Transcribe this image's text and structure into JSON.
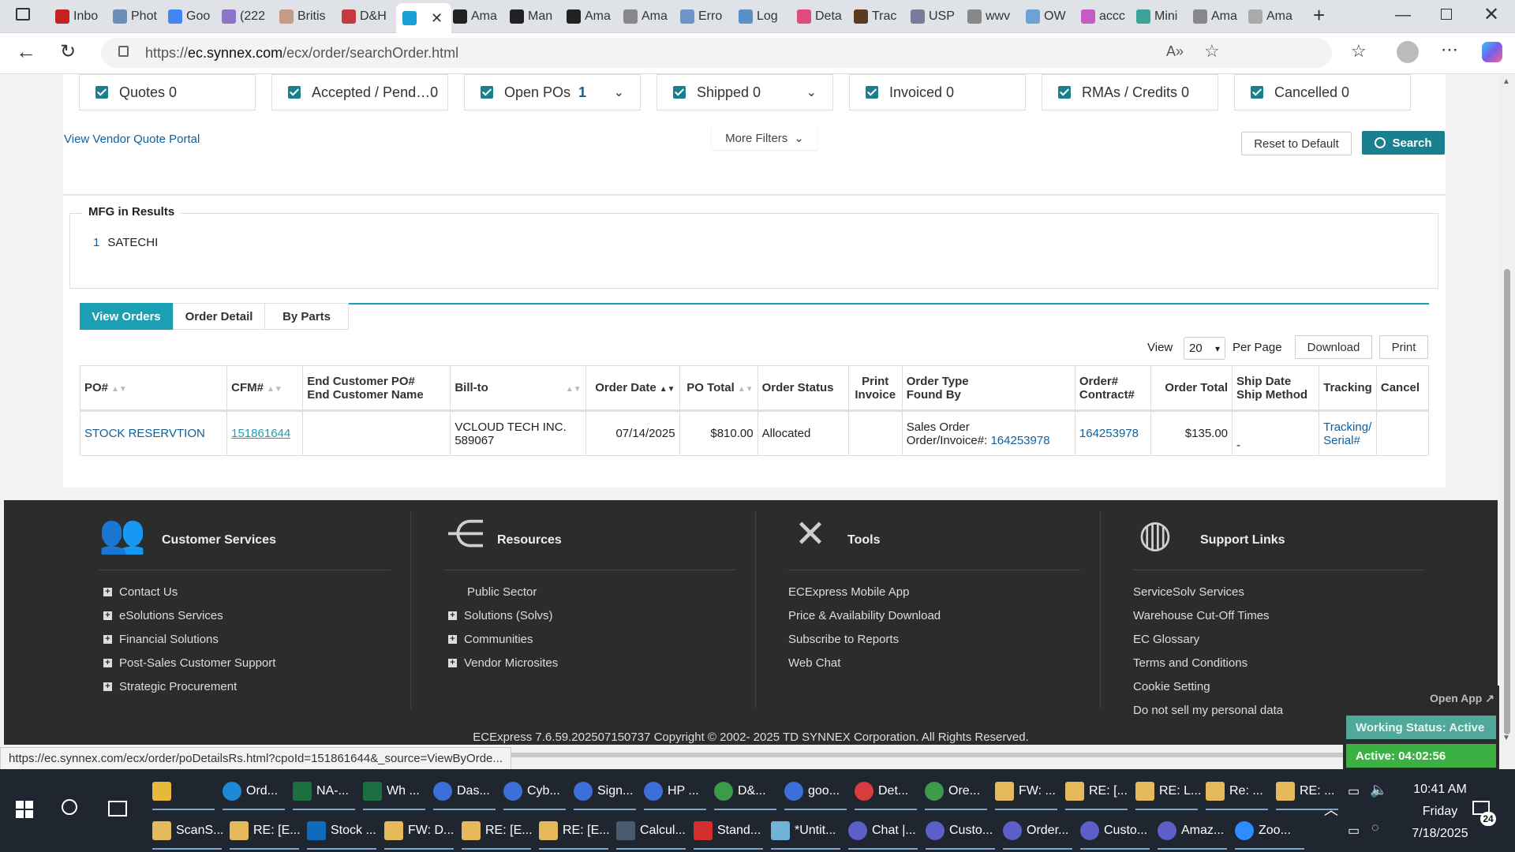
{
  "browser": {
    "tabs": [
      {
        "label": "Inbo",
        "icon": "gmail-icon",
        "color": "#c5221f"
      },
      {
        "label": "Phot",
        "icon": "photo-icon",
        "color": "#6b8db8"
      },
      {
        "label": "Goo",
        "icon": "google-icon",
        "color": "#4285f4"
      },
      {
        "label": "(222",
        "icon": "mail-icon",
        "color": "#8f73c9"
      },
      {
        "label": "Britis",
        "icon": "british-icon",
        "color": "#c79a86"
      },
      {
        "label": "D&H",
        "icon": "dh-icon",
        "color": "#c43b3b"
      },
      {
        "label": "",
        "icon": "ec-icon",
        "color": "#1a9fd6",
        "active": true
      },
      {
        "label": "Ama",
        "icon": "amazon-icon",
        "color": "#222222"
      },
      {
        "label": "Man",
        "icon": "amazon-icon",
        "color": "#222222"
      },
      {
        "label": "Ama",
        "icon": "amazon-icon",
        "color": "#222222"
      },
      {
        "label": "Ama",
        "icon": "amazon-gray-icon",
        "color": "#888888"
      },
      {
        "label": "Erro",
        "icon": "error-icon",
        "color": "#6e95c7"
      },
      {
        "label": "Log",
        "icon": "log-icon",
        "color": "#5b8fc7"
      },
      {
        "label": "Deta",
        "icon": "detail-icon",
        "color": "#e04b7a"
      },
      {
        "label": "Trac",
        "icon": "ups-icon",
        "color": "#5a3a1f"
      },
      {
        "label": "USP",
        "icon": "usps-icon",
        "color": "#7a7a9a"
      },
      {
        "label": "wwv",
        "icon": "link-icon",
        "color": "#888888"
      },
      {
        "label": "OW",
        "icon": "ow-icon",
        "color": "#6ba2d8"
      },
      {
        "label": "accc",
        "icon": "acc-icon",
        "color": "#c45cc4"
      },
      {
        "label": "Mini",
        "icon": "mini-icon",
        "color": "#3aa39a"
      },
      {
        "label": "Ama",
        "icon": "amazon-gray-icon",
        "color": "#888888"
      },
      {
        "label": "Ama",
        "icon": "amazon-gray-icon",
        "color": "#aaaaaa"
      }
    ],
    "url_prefix": "https://",
    "url_domain": "ec.synnex.com",
    "url_path": "/ecx/order/searchOrder.html"
  },
  "filters": [
    {
      "label": "Quotes 0",
      "dropdown": false
    },
    {
      "label": "Accepted / Pend…0",
      "dropdown": false
    },
    {
      "label": "Open POs",
      "count": "1",
      "dropdown": true
    },
    {
      "label": "Shipped 0",
      "dropdown": true
    },
    {
      "label": "Invoiced 0",
      "dropdown": false
    },
    {
      "label": "RMAs / Credits 0",
      "dropdown": false
    },
    {
      "label": "Cancelled 0",
      "dropdown": false
    }
  ],
  "toolbar": {
    "vendor_link": "View Vendor Quote Portal",
    "more_filters": "More Filters",
    "reset": "Reset to Default",
    "search": "Search"
  },
  "mfg": {
    "legend": "MFG in Results",
    "items": [
      {
        "count": "1",
        "name": "SATECHI"
      }
    ]
  },
  "tabs": [
    "View Orders",
    "Order Detail",
    "By Parts"
  ],
  "pager": {
    "view": "View",
    "per_page_value": "20",
    "per_page": "Per Page",
    "download": "Download",
    "print": "Print"
  },
  "table": {
    "headers": {
      "po": "PO#",
      "cfm": "CFM#",
      "end_customer_1": "End Customer PO#",
      "end_customer_2": "End Customer Name",
      "bill_to": "Bill-to",
      "order_date": "Order Date",
      "po_total": "PO Total",
      "order_status": "Order Status",
      "print_1": "Print",
      "print_2": "Invoice",
      "order_type_1": "Order Type",
      "order_type_2": "Found By",
      "order_no_1": "Order#",
      "order_no_2": "Contract#",
      "order_total": "Order Total",
      "ship_1": "Ship Date",
      "ship_2": "Ship Method",
      "tracking": "Tracking",
      "cancel": "Cancel"
    },
    "rows": [
      {
        "po": "STOCK RESERVTION",
        "cfm": "151861644",
        "end_customer": "",
        "bill_to_1": "VCLOUD TECH INC.",
        "bill_to_2": "589067",
        "order_date": "07/14/2025",
        "po_total": "$810.00",
        "order_status": "Allocated",
        "print_invoice": "",
        "order_type_1": "Sales Order",
        "order_type_2": "Order/Invoice#:",
        "order_type_num": "164253978",
        "order_no": "164253978",
        "order_total": "$135.00",
        "ship": "-",
        "tracking_1": "Tracking/",
        "tracking_2": "Serial#",
        "cancel": ""
      }
    ]
  },
  "footer": {
    "columns": [
      {
        "title": "Customer Services",
        "icon": "people-icon",
        "items": [
          {
            "label": "Contact Us",
            "plus": true
          },
          {
            "label": "eSolutions Services",
            "plus": true
          },
          {
            "label": "Financial Solutions",
            "plus": true
          },
          {
            "label": "Post-Sales Customer Support",
            "plus": true
          },
          {
            "label": "Strategic Procurement",
            "plus": true
          }
        ]
      },
      {
        "title": "Resources",
        "icon": "share-icon",
        "items": [
          {
            "label": "Public Sector",
            "plus": false
          },
          {
            "label": "Solutions (Solvs)",
            "plus": true
          },
          {
            "label": "Communities",
            "plus": true
          },
          {
            "label": "Vendor Microsites",
            "plus": true
          }
        ]
      },
      {
        "title": "Tools",
        "icon": "tools-icon",
        "items": [
          {
            "label": "ECExpress Mobile App",
            "plus": false
          },
          {
            "label": "Price & Availability Download",
            "plus": false
          },
          {
            "label": "Subscribe to Reports",
            "plus": false
          },
          {
            "label": "Web Chat",
            "plus": false
          }
        ]
      },
      {
        "title": "Support Links",
        "icon": "globe-icon",
        "items": [
          {
            "label": "ServiceSolv Services",
            "plus": false
          },
          {
            "label": "Warehouse Cut-Off Times",
            "plus": false
          },
          {
            "label": "EC Glossary",
            "plus": false
          },
          {
            "label": "Terms and Conditions",
            "plus": false
          },
          {
            "label": "Cookie Setting",
            "plus": false
          },
          {
            "label": "Do not sell my personal data",
            "plus": false
          }
        ]
      }
    ],
    "copyright": "ECExpress 7.6.59.202507150737 Copyright © 2002- 2025 TD SYNNEX Corporation. All Rights Reserved."
  },
  "widget": {
    "open_app": "Open App ↗",
    "status": "Working Status: Active",
    "active": "Active: 04:02:56"
  },
  "status_url": "https://ec.synnex.com/ecx/order/poDetailsRs.html?cpoId=151861644&_source=ViewByOrde...",
  "taskbar": {
    "row1": [
      {
        "label": "",
        "icon": "folder-icon",
        "color": "#e7b93a"
      },
      {
        "label": "Ord...",
        "icon": "edge-icon",
        "color": "#1e88d6"
      },
      {
        "label": "NA-...",
        "icon": "excel-icon",
        "color": "#1d6f42"
      },
      {
        "label": "Wh ...",
        "icon": "excel-icon",
        "color": "#1d6f42"
      },
      {
        "label": "Das...",
        "icon": "chrome-icon",
        "color": "#3c6fd8"
      },
      {
        "label": "Cyb...",
        "icon": "chrome-icon",
        "color": "#3c6fd8"
      },
      {
        "label": "Sign...",
        "icon": "chrome-icon",
        "color": "#3c6fd8"
      },
      {
        "label": "HP ...",
        "icon": "chrome-icon",
        "color": "#3c6fd8"
      },
      {
        "label": "D&...",
        "icon": "chrome-icon",
        "color": "#3c9a4a"
      },
      {
        "label": "goo...",
        "icon": "chrome-icon",
        "color": "#3c6fd8"
      },
      {
        "label": "Det...",
        "icon": "chrome-icon",
        "color": "#d83c3c"
      },
      {
        "label": "Ore...",
        "icon": "chrome-icon",
        "color": "#3c9a4a"
      },
      {
        "label": "FW: ...",
        "icon": "mail-icon",
        "color": "#e6b85c"
      },
      {
        "label": "RE: [...",
        "icon": "mail-icon",
        "color": "#e6b85c"
      },
      {
        "label": "RE: L...",
        "icon": "mail-icon",
        "color": "#e6b85c"
      },
      {
        "label": "Re: ...",
        "icon": "mail-icon",
        "color": "#e6b85c"
      },
      {
        "label": "RE: ...",
        "icon": "mail-icon",
        "color": "#e6b85c"
      }
    ],
    "row2": [
      {
        "label": "ScanS...",
        "icon": "mail-icon",
        "color": "#e6b85c"
      },
      {
        "label": "RE: [E...",
        "icon": "mail-icon",
        "color": "#e6b85c"
      },
      {
        "label": "Stock ...",
        "icon": "outlook-icon",
        "color": "#0f6cbd"
      },
      {
        "label": "FW: D...",
        "icon": "mail-icon",
        "color": "#e6b85c"
      },
      {
        "label": "RE: [E...",
        "icon": "mail-icon",
        "color": "#e6b85c"
      },
      {
        "label": "RE: [E...",
        "icon": "mail-icon",
        "color": "#e6b85c"
      },
      {
        "label": "Calcul...",
        "icon": "calculator-icon",
        "color": "#4a5a70"
      },
      {
        "label": "Stand...",
        "icon": "pdf-icon",
        "color": "#d32f2f"
      },
      {
        "label": "*Untit...",
        "icon": "notepad-icon",
        "color": "#6fb3d8"
      },
      {
        "label": "Chat |...",
        "icon": "teams-icon",
        "color": "#5b5fc7"
      },
      {
        "label": "Custo...",
        "icon": "teams-icon",
        "color": "#5b5fc7"
      },
      {
        "label": "Order...",
        "icon": "teams-icon",
        "color": "#5b5fc7"
      },
      {
        "label": "Custo...",
        "icon": "teams-icon",
        "color": "#5b5fc7"
      },
      {
        "label": "Amaz...",
        "icon": "teams-icon",
        "color": "#5b5fc7"
      },
      {
        "label": "Zoo...",
        "icon": "zoom-icon",
        "color": "#2d8cff"
      }
    ],
    "clock_time": "10:41 AM",
    "clock_day": "Friday",
    "clock_date": "7/18/2025",
    "notif_count": "24"
  }
}
